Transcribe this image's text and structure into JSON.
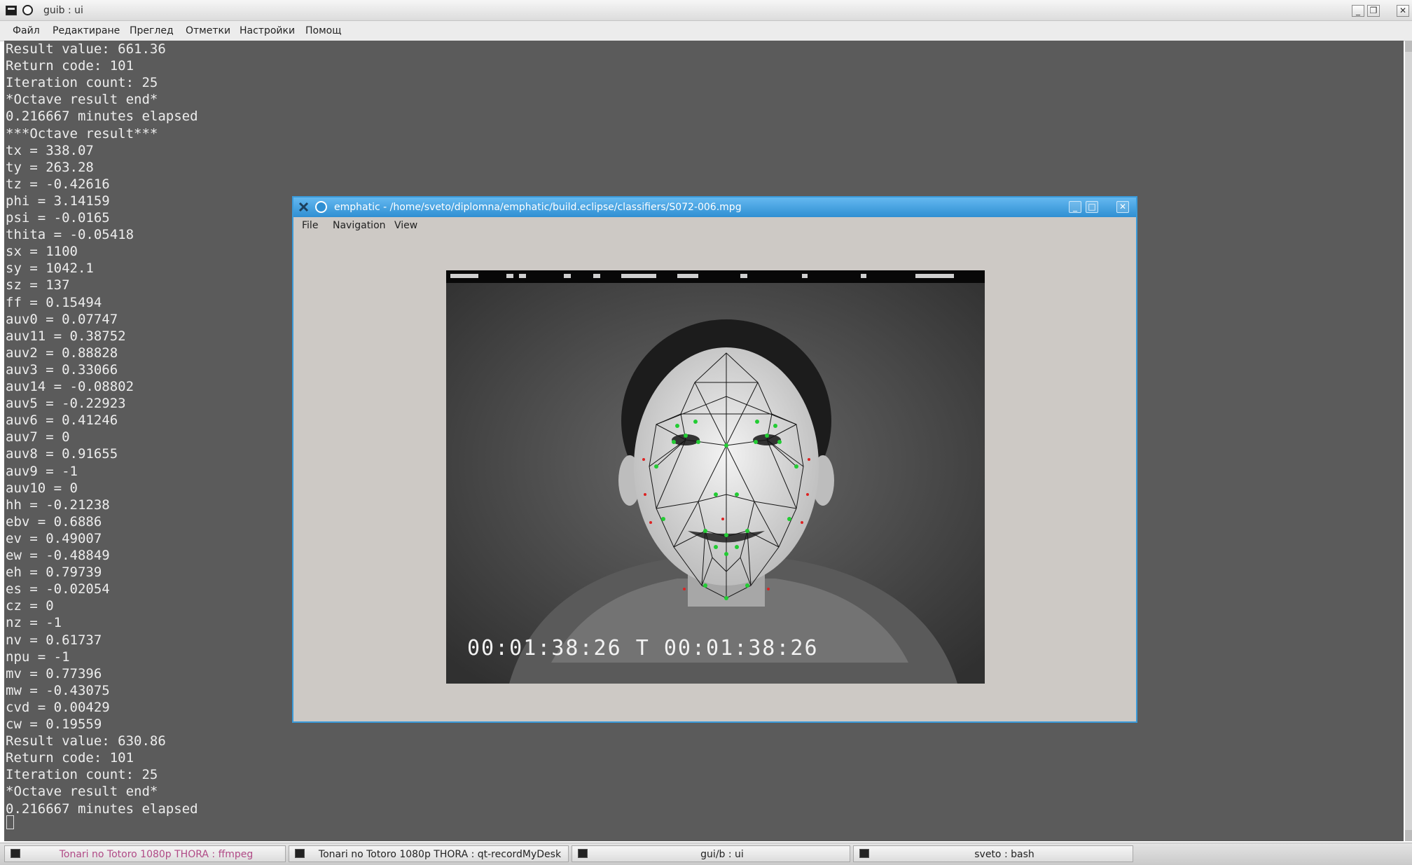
{
  "terminal": {
    "title": "guib : ui",
    "menu": [
      "Файл",
      "Редактиране",
      "Преглед",
      "Отметки",
      "Настройки",
      "Помощ"
    ],
    "lines": [
      "Result value: 661.36",
      "Return code: 101",
      "Iteration count: 25",
      "*Octave result end*",
      "0.216667 minutes elapsed",
      "***Octave result***",
      "tx = 338.07",
      "ty = 263.28",
      "tz = -0.42616",
      "phi = 3.14159",
      "psi = -0.0165",
      "thita = -0.05418",
      "sx = 1100",
      "sy = 1042.1",
      "sz = 137",
      "ff = 0.15494",
      "auv0 = 0.07747",
      "auv11 = 0.38752",
      "auv2 = 0.88828",
      "auv3 = 0.33066",
      "auv14 = -0.08802",
      "auv5 = -0.22923",
      "auv6 = 0.41246",
      "auv7 = 0",
      "auv8 = 0.91655",
      "auv9 = -1",
      "auv10 = 0",
      "hh = -0.21238",
      "ebv = 0.6886",
      "ev = 0.49007",
      "ew = -0.48849",
      "eh = 0.79739",
      "es = -0.02054",
      "cz = 0",
      "nz = -1",
      "nv = 0.61737",
      "npu = -1",
      "mv = 0.77396",
      "mw = -0.43075",
      "cvd = 0.00429",
      "cw = 0.19559",
      "Result value: 630.86",
      "Return code: 101",
      "Iteration count: 25",
      "*Octave result end*",
      "0.216667 minutes elapsed"
    ]
  },
  "app": {
    "title": "emphatic - /home/sveto/diplomna/emphatic/build.eclipse/classifiers/S072-006.mpg",
    "menu": [
      "File",
      "Navigation",
      "View"
    ],
    "video": {
      "timecode": "00:01:38:26 T 00:01:38:26"
    }
  },
  "taskbar": [
    {
      "label": "Tonari no Totoro 1080p THORA : ffmpeg",
      "color": "#b04a86"
    },
    {
      "label": "Tonari no Totoro 1080p THORA : qt-recordMyDesk",
      "color": "#222222"
    },
    {
      "label": "gui/b : ui",
      "color": "#222222"
    },
    {
      "label": "sveto : bash",
      "color": "#222222"
    }
  ],
  "colors": {
    "terminal_bg": "#5b5b5b",
    "terminal_fg": "#ededed",
    "app_title_active": "#3a9ad9",
    "landmark_green": "#22cc33",
    "landmark_red": "#dd2222"
  }
}
